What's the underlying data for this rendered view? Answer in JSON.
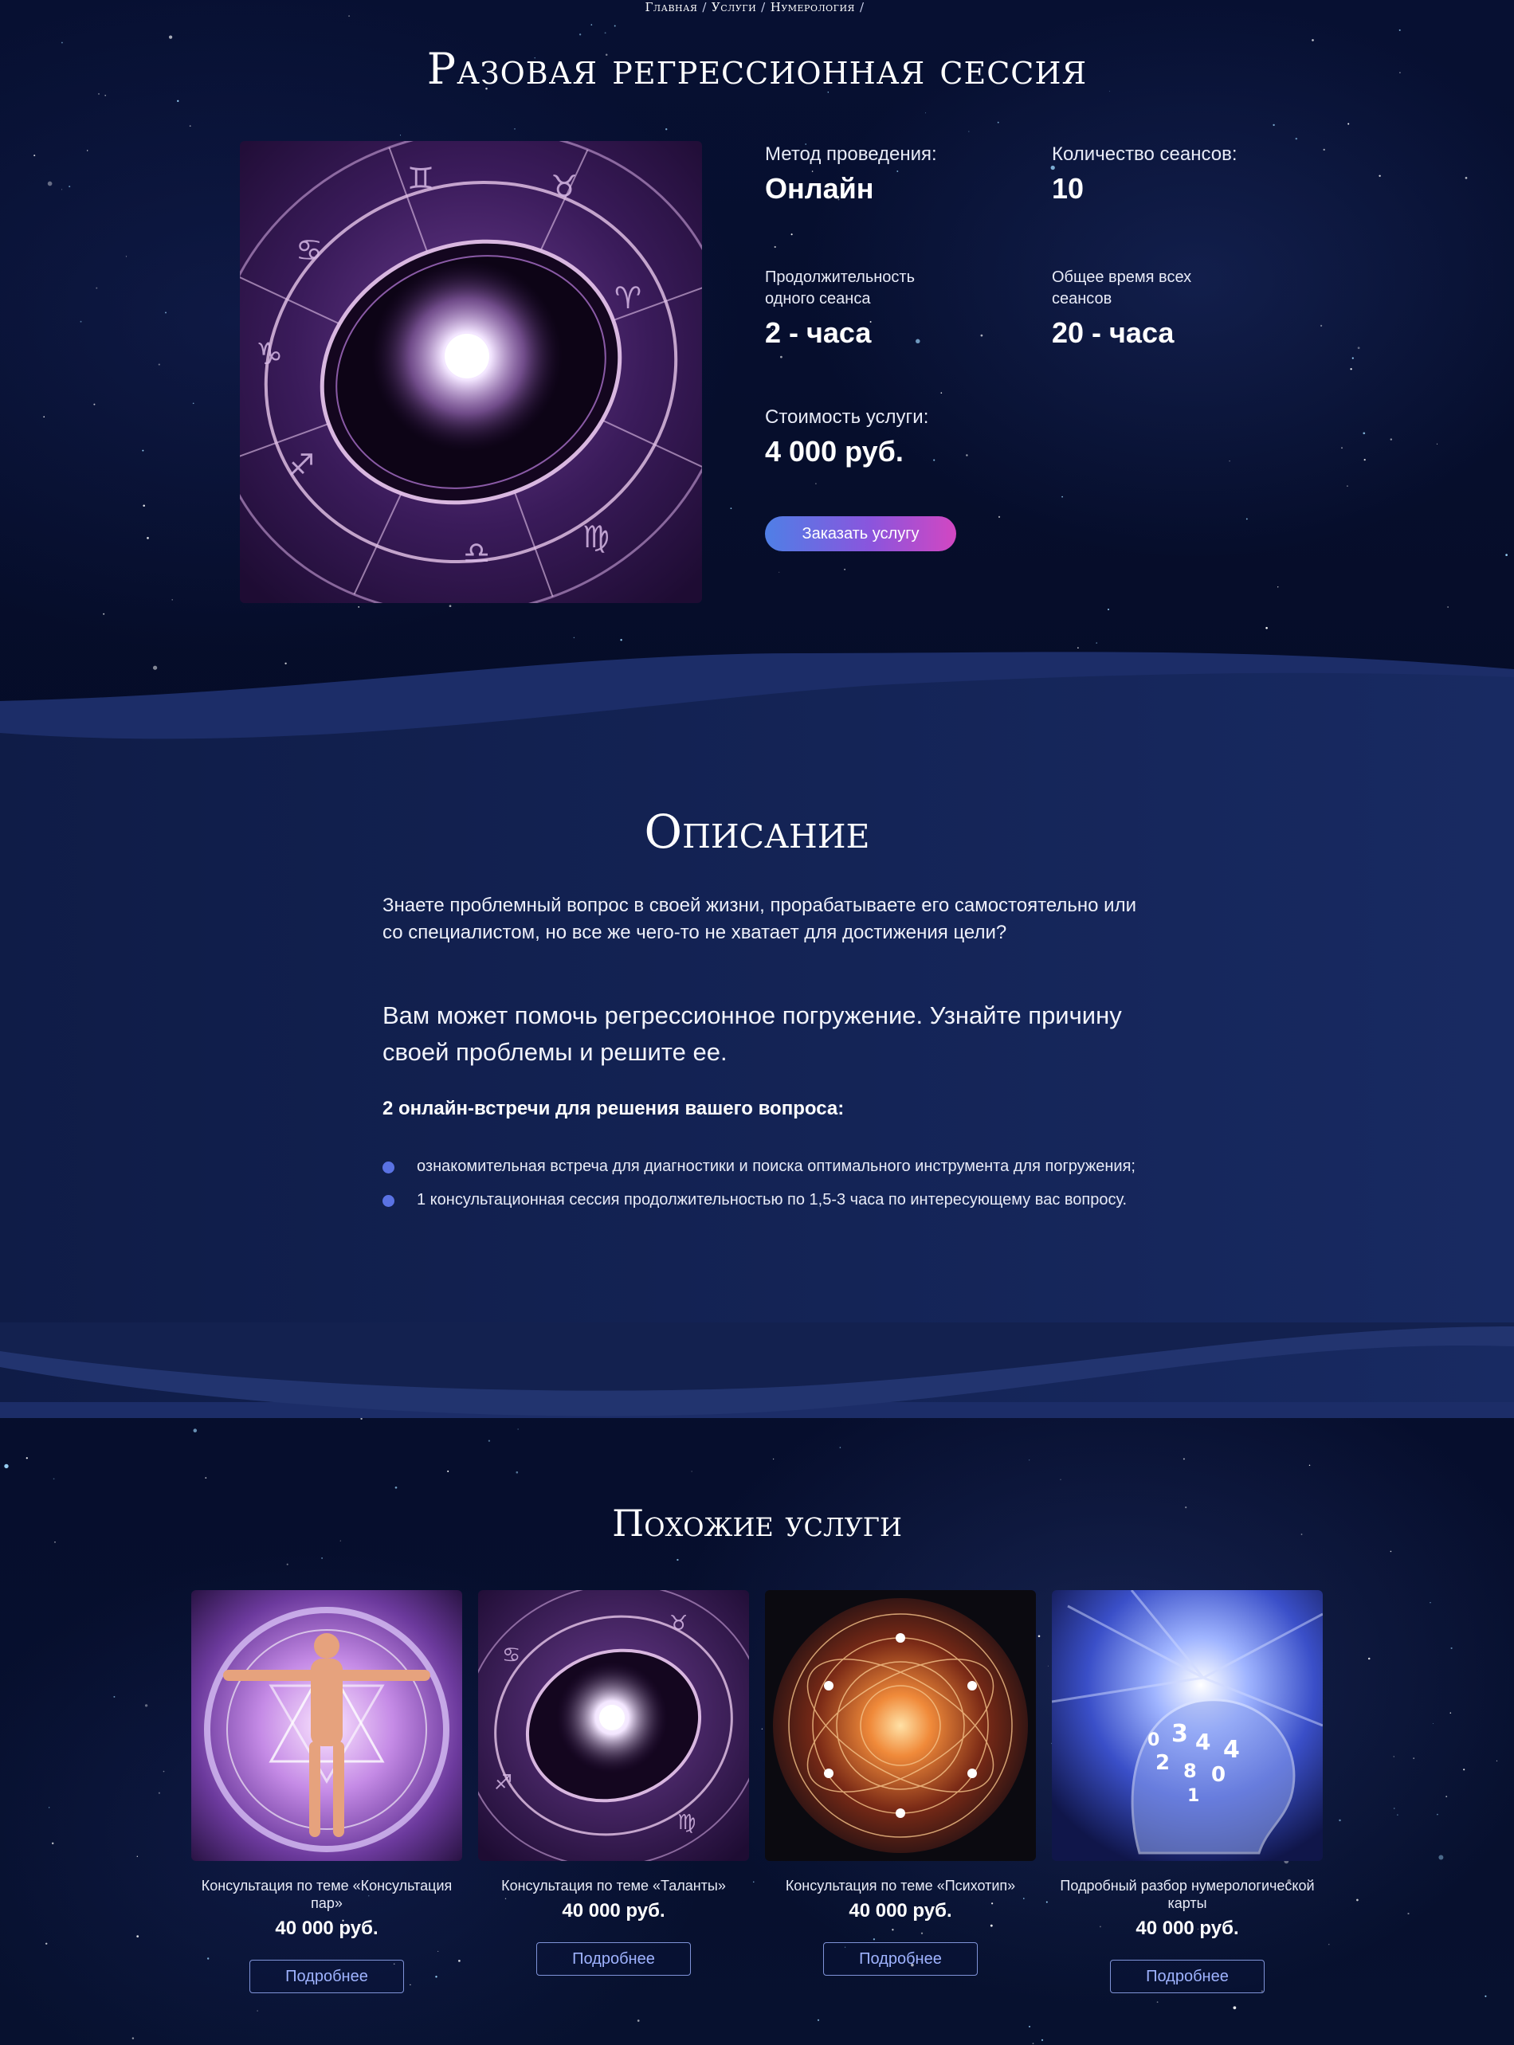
{
  "breadcrumb": {
    "items": [
      "Главная",
      "Услуги",
      "Нумерология"
    ],
    "separator": "/"
  },
  "page": {
    "title": "Разовая регрессионная сессия"
  },
  "service": {
    "method_label": "Метод проведения:",
    "method_value": "Онлайн",
    "sessions_label": "Количество сеансов:",
    "sessions_value": "10",
    "duration_label": "Продолжительность одного сеанса",
    "duration_value": "2 - часа",
    "total_label": "Общее время всех сеансов",
    "total_value": "20 - часа",
    "price_label": "Стоимость услуги:",
    "price_value": "4 000 руб.",
    "order_button": "Заказать услугу"
  },
  "description": {
    "title": "Описание",
    "paragraph1": "Знаете проблемный вопрос в своей жизни, прорабатываете его самостоятельно или со специалистом, но все же чего-то не хватает для достижения цели?",
    "paragraph2": "Вам может помочь регрессионное погружение. Узнайте причину своей проблемы и решите ее.",
    "paragraph3": "2 онлайн-встречи для решения вашего вопроса:",
    "bullets": [
      "ознакомительная встреча для диагностики и поиска оптимального инструмента для погружения;",
      "1 консультационная сессия продолжительностью по 1,5-3 часа по интересующему вас вопросу."
    ]
  },
  "similar": {
    "title": "Похожие услуги",
    "cards": [
      {
        "name": "Консультация по теме «Консультация пар»",
        "price": "40 000 руб.",
        "button": "Подробнее"
      },
      {
        "name": "Консультация по теме «Таланты»",
        "price": "40 000 руб.",
        "button": "Подробнее"
      },
      {
        "name": "Консультация по теме «Психотип»",
        "price": "40 000 руб.",
        "button": "Подробнее"
      },
      {
        "name": "Подробный разбор нумерологической карты",
        "price": "40 000 руб.",
        "button": "Подробнее"
      }
    ]
  },
  "colors": {
    "background": "#050b22",
    "band": "#13214f",
    "wave_light": "#22346f",
    "bullet": "#5a72e3",
    "button_gradient_start": "#4f7fe6",
    "button_gradient_end": "#d247c2",
    "outline_button": "#7f93d8"
  }
}
